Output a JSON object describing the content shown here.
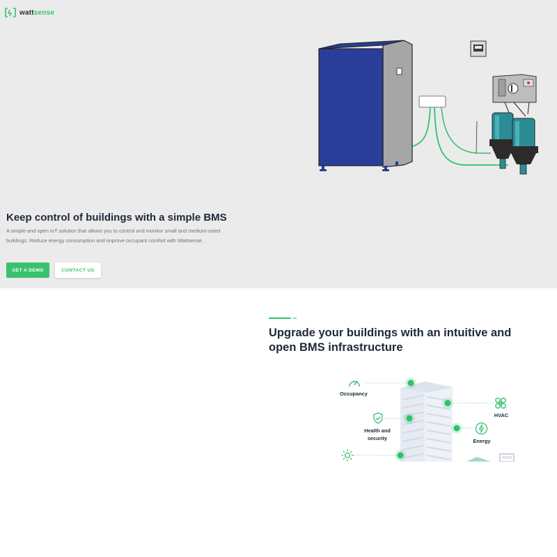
{
  "brand": {
    "name_part1": "watt",
    "name_part2": "sense",
    "accent_color": "#33c46b"
  },
  "hero": {
    "title": "Keep control of buildings with a simple BMS",
    "description": "A simple and open IoT solution that allows you to control and monitor small and medium-sized buildings. Reduce energy consumption and improve occupant comfort with Wattsense.",
    "cta_primary": "GET A DEMO",
    "cta_secondary": "CONTACT US",
    "background_color": "#ebebeb"
  },
  "section": {
    "title": "Upgrade your buildings with an intuitive and open BMS infrastructure",
    "features": {
      "occupancy": "Occupancy",
      "hvac": "HVAC",
      "health_line1": "Health and",
      "health_line2": "security",
      "energy": "Energy"
    }
  }
}
